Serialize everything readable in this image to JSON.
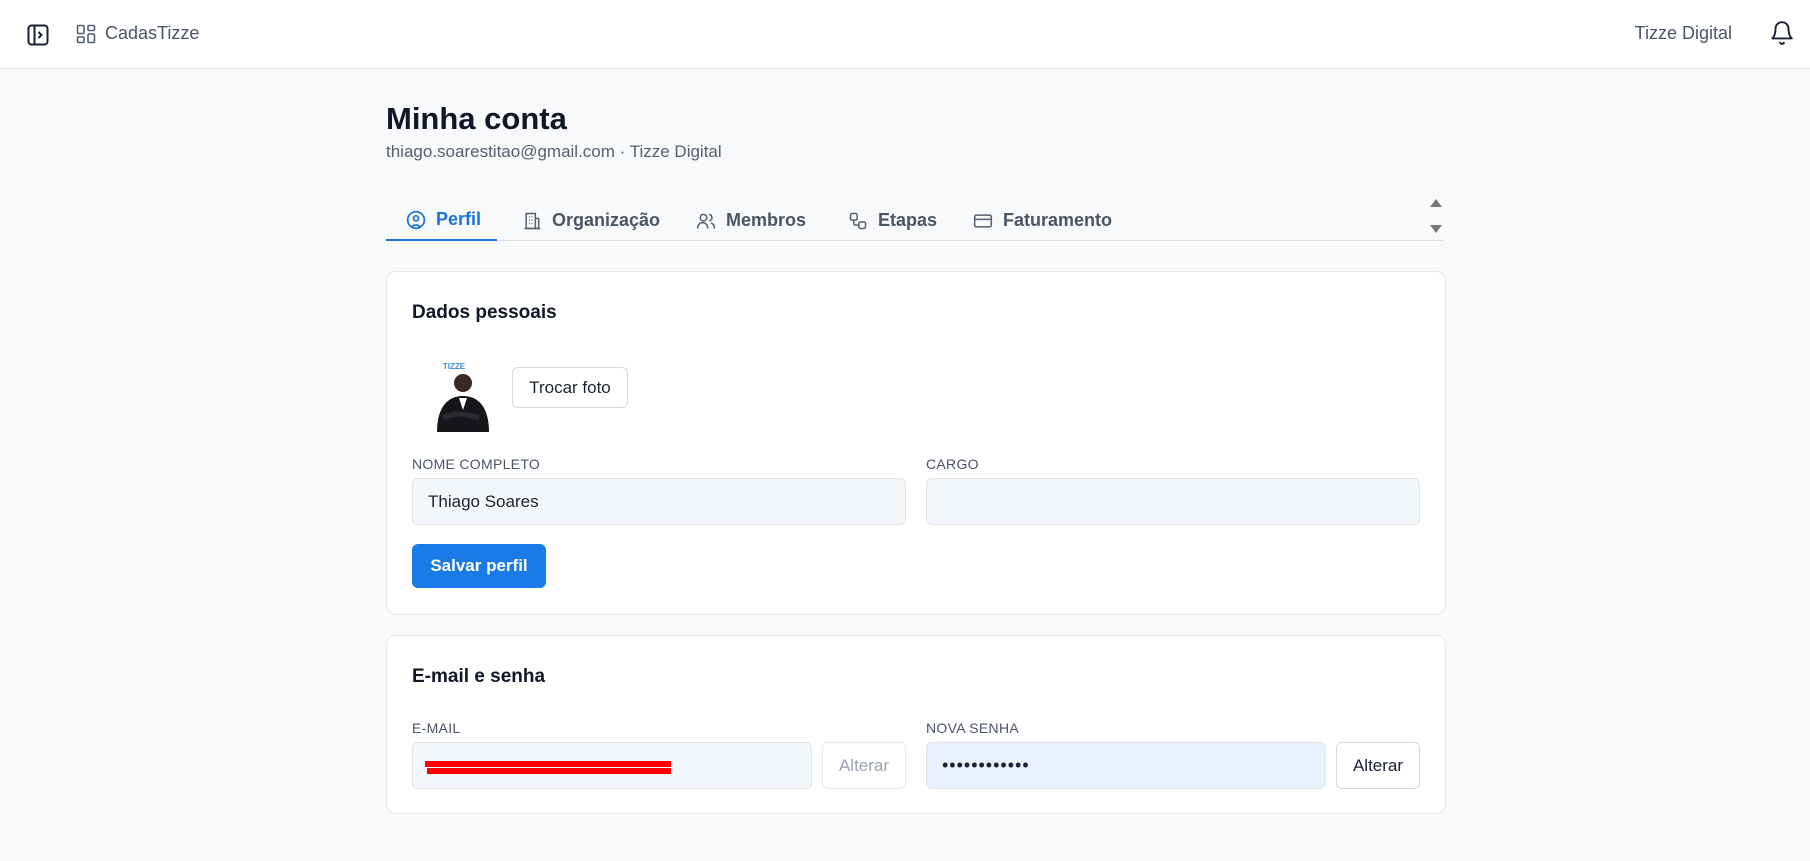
{
  "topbar": {
    "app_name": "CadasTizze",
    "org_name": "Tizze Digital"
  },
  "header": {
    "title": "Minha conta",
    "subtitle": "thiago.soarestitao@gmail.com · Tizze Digital"
  },
  "tabs": [
    {
      "label": "Perfil",
      "icon": "user-circle-icon",
      "active": true
    },
    {
      "label": "Organização",
      "icon": "building-icon",
      "active": false
    },
    {
      "label": "Membros",
      "icon": "users-icon",
      "active": false
    },
    {
      "label": "Etapas",
      "icon": "workflow-icon",
      "active": false
    },
    {
      "label": "Faturamento",
      "icon": "credit-card-icon",
      "active": false
    }
  ],
  "profile": {
    "title": "Dados pessoais",
    "change_photo": "Trocar foto",
    "name_label": "NOME COMPLETO",
    "name_value": "Thiago Soares",
    "role_label": "CARGO",
    "role_value": "",
    "save_label": "Salvar perfil",
    "avatar_text": "TIZZE"
  },
  "security": {
    "title": "E-mail e senha",
    "email_label": "E-MAIL",
    "email_alter": "Alterar",
    "password_label": "NOVA SENHA",
    "password_value": "••••••••••••",
    "password_alter": "Alterar"
  },
  "colors": {
    "accent": "#1a7ae8",
    "tab_active": "#1a73d9",
    "background": "#f7f9fb",
    "redaction": "#ff0000"
  }
}
